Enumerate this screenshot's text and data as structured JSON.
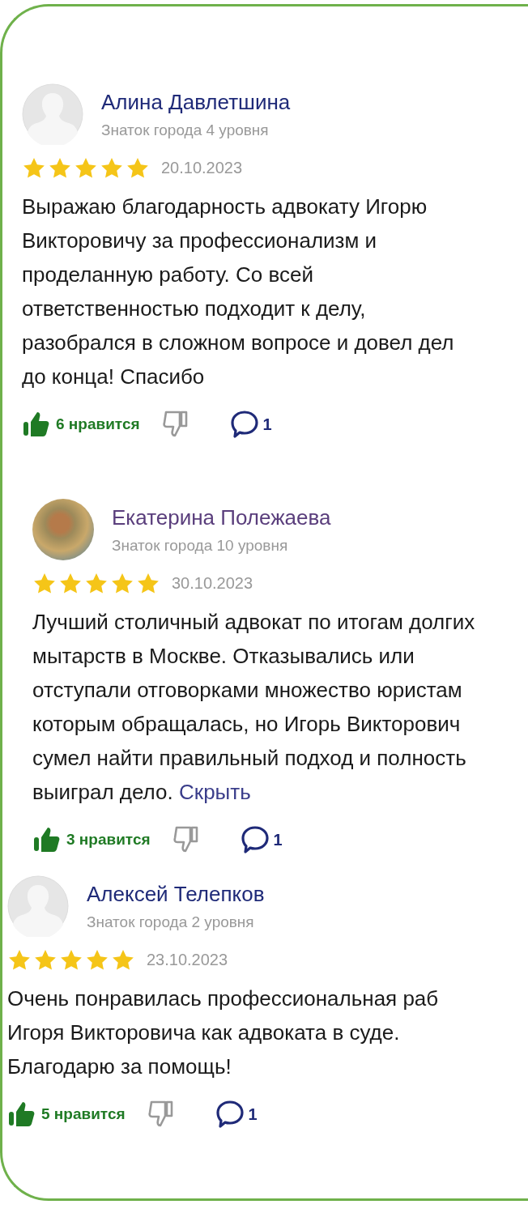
{
  "reviews": [
    {
      "author": "Алина Давлетшина",
      "visited": false,
      "avatar": {
        "kind": "silhouette"
      },
      "level_text": "Знаток города 4 уровня",
      "stars": 5,
      "date": "20.10.2023",
      "body_lines": [
        "Выражаю благодарность адвокату Игорю",
        "Викторовичу за профессионализм и",
        "проделанную работу. Со всей",
        "ответственностью подходит к делу,",
        "разобрался в сложном вопросе и довел дел",
        "до конца! Спасибо"
      ],
      "likes": "6 нравится",
      "comments": "1"
    },
    {
      "author": "Екатерина Полежаева",
      "visited": true,
      "avatar": {
        "kind": "photo"
      },
      "level_text": "Знаток города 10 уровня",
      "stars": 5,
      "date": "30.10.2023",
      "body_lines": [
        "Лучший столичный адвокат по итогам долгих",
        "мытарств в Москве. Отказывались или",
        "отступали отговорками множество юристам",
        "которым обращалась, но Игорь Викторович",
        "сумел найти правильный подход и полность",
        "выиграл дело."
      ],
      "toggle_link": "Скрыть",
      "likes": "3 нравится",
      "comments": "1"
    },
    {
      "author": "Алексей Телепков",
      "visited": false,
      "avatar": {
        "kind": "silhouette"
      },
      "level_text": "Знаток города 2 уровня",
      "stars": 5,
      "date": "23.10.2023",
      "body_lines": [
        "Очень понравилась профессиональная раб",
        "Игоря Викторовича как адвоката в суде.",
        "Благодарю за помощь!"
      ],
      "likes": "5 нравится",
      "comments": "1"
    }
  ]
}
